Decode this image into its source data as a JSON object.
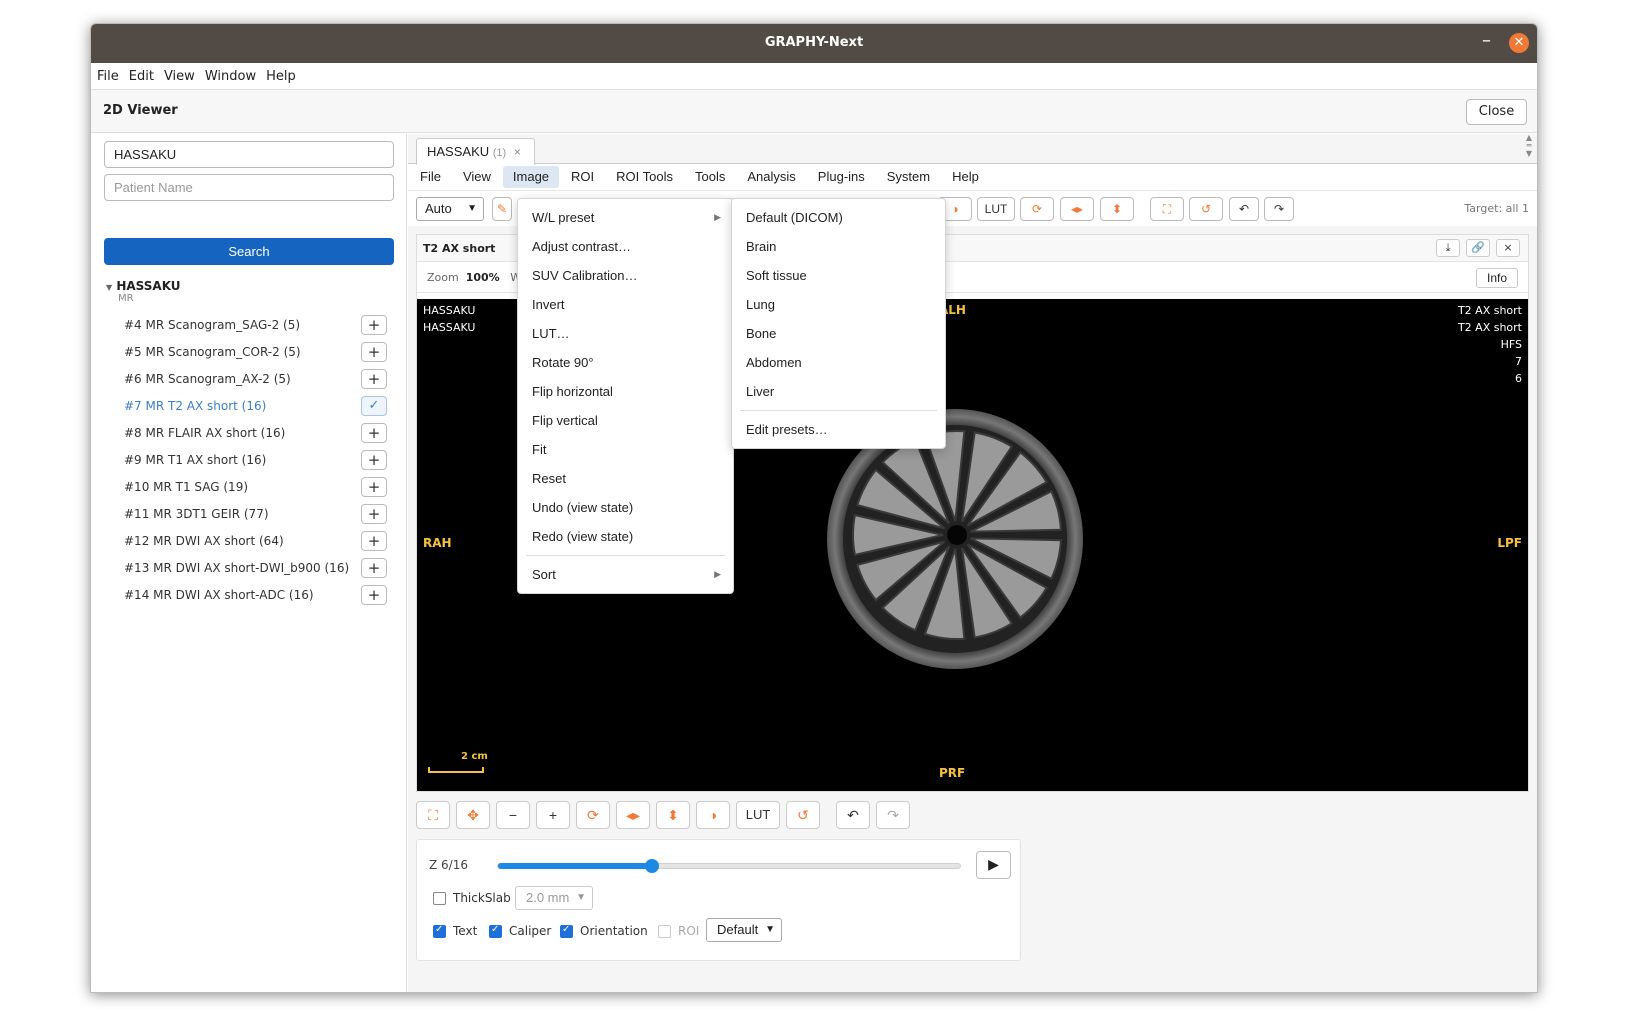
{
  "window": {
    "title": "GRAPHY-Next"
  },
  "app_menu": [
    "File",
    "Edit",
    "View",
    "Window",
    "Help"
  ],
  "viewer": {
    "title": "2D Viewer",
    "close_label": "Close"
  },
  "sidebar": {
    "search_value": "HASSAKU",
    "patient_placeholder": "Patient Name",
    "search_button": "Search",
    "patient": {
      "name": "HASSAKU",
      "modality": "MR"
    },
    "series": [
      {
        "label": "#4 MR Scanogram_SAG-2 (5)",
        "action": "+"
      },
      {
        "label": "#5 MR Scanogram_COR-2 (5)",
        "action": "+"
      },
      {
        "label": "#6 MR Scanogram_AX-2 (5)",
        "action": "+"
      },
      {
        "label": "#7 MR T2 AX short (16)",
        "action": "✓"
      },
      {
        "label": "#8 MR FLAIR AX short (16)",
        "action": "+"
      },
      {
        "label": "#9 MR T1 AX short (16)",
        "action": "+"
      },
      {
        "label": "#10 MR T1 SAG (19)",
        "action": "+"
      },
      {
        "label": "#11 MR 3DT1 GEIR (77)",
        "action": "+"
      },
      {
        "label": "#12 MR DWI AX short (64)",
        "action": "+"
      },
      {
        "label": "#13 MR DWI AX short-DWI_b900 (16)",
        "action": "+"
      },
      {
        "label": "#14 MR DWI AX short-ADC (16)",
        "action": "+"
      }
    ]
  },
  "tab": {
    "label": "HASSAKU",
    "count": "(1)",
    "close": "×"
  },
  "menubar": [
    "File",
    "View",
    "Image",
    "ROI",
    "ROI Tools",
    "Tools",
    "Analysis",
    "Plug-ins",
    "System",
    "Help"
  ],
  "toolbar": {
    "mode": "Auto",
    "lut": "LUT",
    "target": "Target: all 1"
  },
  "viewport": {
    "title": "T2 AX short",
    "zoom_label": "Zoom",
    "zoom_value": "100%",
    "zoom_extra": "W",
    "info": "Info",
    "overlay_top_left": [
      "HASSAKU",
      "HASSAKU"
    ],
    "overlay_top_right": [
      "T2 AX short",
      "T2 AX short",
      "HFS",
      "7",
      "6"
    ],
    "orient_top": "ALH",
    "orient_left": "RAH",
    "orient_right": "LPF",
    "orient_bottom": "PRF",
    "scale_label": "2 cm"
  },
  "bottom_toolbar": {
    "lut": "LUT"
  },
  "controls": {
    "slice_label": "Z 6/16",
    "slice_current": 6,
    "slice_total": 16,
    "thickslab_label": "ThickSlab",
    "thickslab_value": "2.0 mm",
    "text_label": "Text",
    "caliper_label": "Caliper",
    "orientation_label": "Orientation",
    "roi_label": "ROI",
    "preset": "Default"
  },
  "image_menu": {
    "items": [
      "W/L preset",
      "Adjust contrast…",
      "SUV Calibration…",
      "Invert",
      "LUT…",
      "Rotate 90°",
      "Flip horizontal",
      "Flip vertical",
      "Fit",
      "Reset",
      "Undo (view state)",
      "Redo (view state)"
    ],
    "sort": "Sort"
  },
  "wl_submenu": {
    "items": [
      "Default (DICOM)",
      "Brain",
      "Soft tissue",
      "Lung",
      "Bone",
      "Abdomen",
      "Liver"
    ],
    "edit": "Edit presets…"
  },
  "colors": {
    "accent": "#f27935",
    "primary": "#1565c0",
    "orientation": "#f5c240"
  }
}
